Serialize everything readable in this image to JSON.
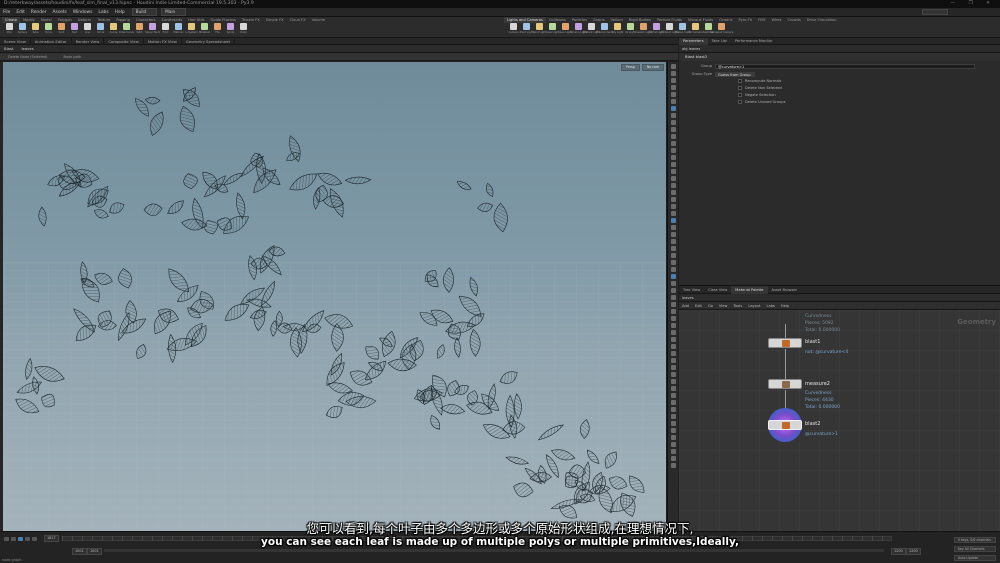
{
  "window": {
    "title": "D:/reterkway/assets/houdini/fx/leaf_sim_final_v13.hipnc - Houdini Indie Limited-Commercial 19.5.303 - Py3.9",
    "controls": "— ❐ ✕"
  },
  "menu": {
    "items": [
      "File",
      "Edit",
      "Render",
      "Assets",
      "Windows",
      "Labs",
      "Help"
    ],
    "desktop": "Build",
    "search_shelf": "Main"
  },
  "shelf": {
    "left_tabs": [
      "Create",
      "Modify",
      "Model",
      "Polygon",
      "Deform",
      "Texture",
      "Rigging",
      "Characters",
      "Constraints",
      "Hair Utils",
      "Guide Process",
      "Terrain FX",
      "Simple FX",
      "Cloud FX",
      "Volume"
    ],
    "right_tabs": [
      "Lights and Cameras",
      "Collisions",
      "Particles",
      "Grains",
      "Vellum",
      "Rigid Bodies",
      "Particle Fluids",
      "Viscous Fluids",
      "Oceans",
      "Pyro FX",
      "FEM",
      "Wires",
      "Crowds",
      "Drive Simulation"
    ],
    "left_tools": [
      "Box",
      "Sphere",
      "Tube",
      "Torus",
      "Grid",
      "Null",
      "Line",
      "Circle",
      "Curve",
      "Draw Curve",
      "Path",
      "Spray Paint",
      "Font",
      "Platonic",
      "L-System",
      "Metaball",
      "File",
      "Spiral",
      "Helix"
    ],
    "right_tools": [
      "Camera",
      "Point Light",
      "Spot Light",
      "Area Light",
      "Geo Light",
      "Volume Light",
      "Distant Light",
      "Environment",
      "Sky Light",
      "GI Light",
      "Caustic Light",
      "Portal Light",
      "Ambient Light",
      "Stereo Cam",
      "VR Camera",
      "Switcher",
      "Gamepad Camera"
    ]
  },
  "viewport": {
    "path_tabs": [
      "Scene View",
      "Animation Editor",
      "Render View",
      "Composite View",
      "Motion FX View",
      "Geometry Spreadsheet"
    ],
    "tab": "Blast",
    "path": "leaves",
    "info": [
      "Delete Node (Selected)",
      "Node path",
      "Light: Headlight"
    ],
    "camera": "Persp",
    "cam_mode": "No cam"
  },
  "parameters": {
    "tabs": [
      "Parameters",
      "Take List",
      "Performance Monitor"
    ],
    "path": "obj  leaves",
    "node_type": "Blast  blast2",
    "group_label": "Group",
    "group_value": "@curvature>1",
    "group_type_label": "Group Type",
    "group_type_value": "Guess from Group",
    "toggles": [
      "Recompute Normals",
      "Delete Non Selected",
      "Negate Selection",
      "Delete Unused Groups"
    ]
  },
  "network": {
    "tabs": [
      "Tree View",
      "Class View",
      "Material Palette",
      "Asset Browser"
    ],
    "path": "leaves",
    "menu": [
      "Add",
      "Edit",
      "Go",
      "View",
      "Tools",
      "Layout",
      "Labs",
      "Help"
    ],
    "context_label": "Geometry",
    "top_info": "Curvedness\nPieces: 5092\nTotal: 0.000000",
    "nodes": [
      {
        "name": "blast1",
        "comment": "not: @curvature<4"
      },
      {
        "name": "measure2",
        "comment": "Curvedness\nPieces: 4430\nTotal: 0.000000"
      },
      {
        "name": "blast2",
        "comment": "@curvature>1"
      }
    ]
  },
  "timeline": {
    "current_frame": "1817",
    "start": "1001",
    "start2": "1001",
    "end": "1200",
    "end2": "1200",
    "keys_label": "0 keys, 0/0 channels",
    "key_all": "Key All Channels",
    "auto_update": "Auto Update",
    "status": "node graph"
  },
  "subtitles": {
    "cn": "您可以看到,每个叶子由多个多边形或多个原始形状组成,在理想情况下,",
    "en": "you can see each leaf is made up of multiple polys or multiple primitives,Ideally,"
  },
  "colors": {
    "accent": "#4a7fb0",
    "node_icon": "#c06a2a",
    "info_text": "#79a8cf",
    "sky_top": "#6f8b9a",
    "sky_bottom": "#a4b3bb"
  }
}
